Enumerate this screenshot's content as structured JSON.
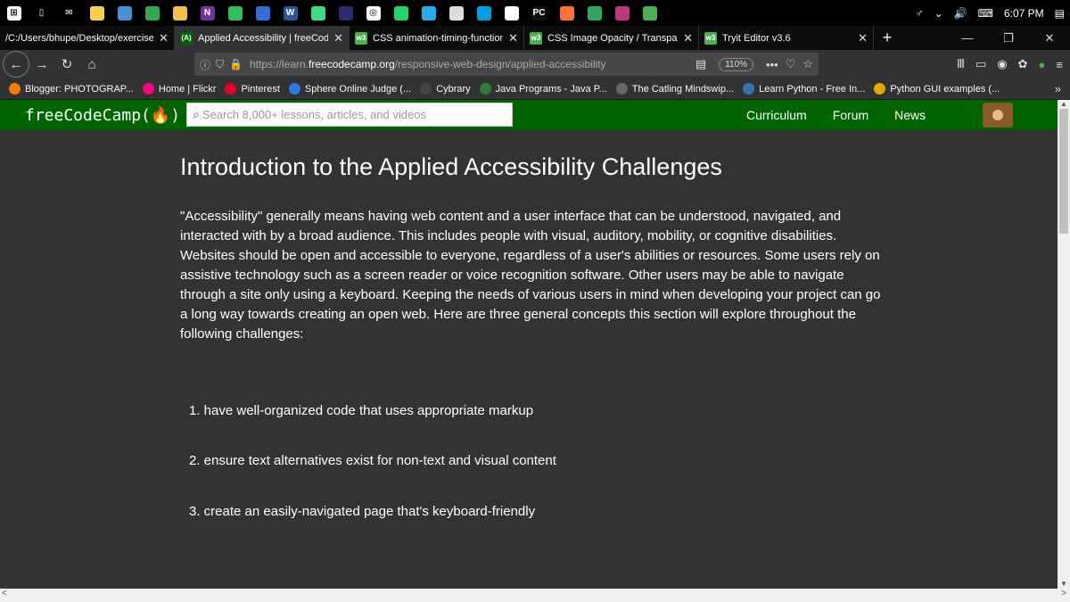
{
  "taskbar": {
    "icons": [
      {
        "name": "windows-start-icon",
        "color": "#ffffff",
        "glyph": "⊞"
      },
      {
        "name": "task-view-icon",
        "color": "#000000",
        "glyph": "▯"
      },
      {
        "name": "mail-icon",
        "color": "#000000",
        "glyph": "✉"
      },
      {
        "name": "sticky-notes-icon",
        "color": "#f7d14c",
        "glyph": ""
      },
      {
        "name": "files-icon",
        "color": "#4a90d9",
        "glyph": ""
      },
      {
        "name": "chrome-icon",
        "color": "#34a853",
        "glyph": ""
      },
      {
        "name": "folder-icon",
        "color": "#f2c14e",
        "glyph": ""
      },
      {
        "name": "onenote-icon",
        "color": "#7b2f9f",
        "glyph": "N"
      },
      {
        "name": "evernote-icon",
        "color": "#2dbe60",
        "glyph": ""
      },
      {
        "name": "photos-icon",
        "color": "#2d6fd6",
        "glyph": ""
      },
      {
        "name": "word-icon",
        "color": "#2b579a",
        "glyph": "W"
      },
      {
        "name": "android-icon",
        "color": "#3ddc84",
        "glyph": ""
      },
      {
        "name": "app-icon",
        "color": "#2b2b6f",
        "glyph": ""
      },
      {
        "name": "opera-icon",
        "color": "#ffffff",
        "glyph": "◎"
      },
      {
        "name": "whatsapp-icon",
        "color": "#25d366",
        "glyph": ""
      },
      {
        "name": "telegram-icon",
        "color": "#2aabee",
        "glyph": ""
      },
      {
        "name": "usb-icon",
        "color": "#dddddd",
        "glyph": ""
      },
      {
        "name": "screenshot-icon",
        "color": "#00a0e0",
        "glyph": ""
      },
      {
        "name": "shield-icon",
        "color": "#ffffff",
        "glyph": ""
      },
      {
        "name": "pycharm-icon",
        "color": "#111111",
        "glyph": "PC"
      },
      {
        "name": "firefox-icon",
        "color": "#ff7139",
        "glyph": ""
      },
      {
        "name": "record-icon",
        "color": "#30a85f",
        "glyph": ""
      },
      {
        "name": "instagram-icon",
        "color": "#c13584",
        "glyph": ""
      },
      {
        "name": "greenapp-icon",
        "color": "#4caf50",
        "glyph": ""
      }
    ],
    "tray": {
      "time": "6:07 PM"
    }
  },
  "tabs": [
    {
      "title": "/C:/Users/bhupe/Desktop/exercise",
      "fav_color": "#555555",
      "active": false
    },
    {
      "title": "Applied Accessibility | freeCode",
      "fav_color": "#006400",
      "active": true
    },
    {
      "title": "CSS animation-timing-function",
      "fav_color": "#4caf50",
      "active": false
    },
    {
      "title": "CSS Image Opacity / Transpare",
      "fav_color": "#4caf50",
      "active": false
    },
    {
      "title": "Tryit Editor v3.6",
      "fav_color": "#4caf50",
      "active": false
    }
  ],
  "navbar": {
    "url_prefix": "https://learn.",
    "url_host": "freecodecamp.org",
    "url_path": "/responsive-web-design/applied-accessibility",
    "zoom": "110%"
  },
  "bookmarks": [
    {
      "label": "Blogger: PHOTOGRAP...",
      "color": "#f57d00"
    },
    {
      "label": "Home | Flickr",
      "color": "#ff0084"
    },
    {
      "label": "Pinterest",
      "color": "#e60023"
    },
    {
      "label": "Sphere Online Judge (...",
      "color": "#2a7ae2"
    },
    {
      "label": "Cybrary",
      "color": "#444444"
    },
    {
      "label": "Java Programs - Java P...",
      "color": "#2e7d32"
    },
    {
      "label": "The Catling Mindswip...",
      "color": "#666666"
    },
    {
      "label": "Learn Python - Free In...",
      "color": "#3776ab"
    },
    {
      "label": "Python GUI examples (...",
      "color": "#e0a800"
    }
  ],
  "fcc": {
    "logo": "freeCodeCamp(🔥)",
    "search_placeholder": "Search 8,000+ lessons, articles, and videos",
    "links": [
      "Curriculum",
      "Forum",
      "News"
    ]
  },
  "content": {
    "title": "Introduction to the Applied Accessibility Challenges",
    "paragraph": "\"Accessibility\" generally means having web content and a user interface that can be understood, navigated, and interacted with by a broad audience. This includes people with visual, auditory, mobility, or cognitive disabilities. Websites should be open and accessible to everyone, regardless of a user's abilities or resources. Some users rely on assistive technology such as a screen reader or voice recognition software. Other users may be able to navigate through a site only using a keyboard. Keeping the needs of various users in mind when developing your project can go a long way towards creating an open web. Here are three general concepts this section will explore throughout the following challenges:",
    "items": [
      "1. have well-organized code that uses appropriate markup",
      "2. ensure text alternatives exist for non-text and visual content",
      "3. create an easily-navigated page that's keyboard-friendly"
    ]
  }
}
